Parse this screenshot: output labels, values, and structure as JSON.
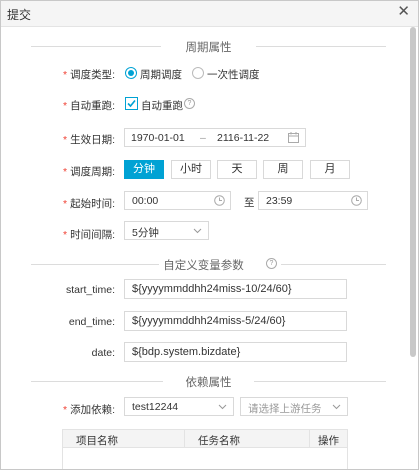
{
  "dialog": {
    "title": "提交"
  },
  "section_period": {
    "label": "周期属性"
  },
  "schedule_type": {
    "label": "调度类型:",
    "options": [
      "周期调度",
      "一次性调度"
    ],
    "selected": "周期调度"
  },
  "auto_rerun": {
    "label": "自动重跑:",
    "checkbox_label": "自动重跑",
    "checked": true
  },
  "effective_date": {
    "label": "生效日期:",
    "start": "1970-01-01",
    "separator": "–",
    "end": "2116-11-22"
  },
  "schedule_period": {
    "label": "调度周期:",
    "options": [
      "分钟",
      "小时",
      "天",
      "周",
      "月"
    ],
    "selected": "分钟"
  },
  "start_time": {
    "label": "起始时间:",
    "from": "00:00",
    "to_label": "至",
    "to": "23:59"
  },
  "interval": {
    "label": "时间间隔:",
    "value": "5分钟"
  },
  "section_params": {
    "label": "自定义变量参数"
  },
  "params": [
    {
      "label": "start_time:",
      "value": "${yyyymmddhh24miss-10/24/60}"
    },
    {
      "label": "end_time:",
      "value": "${yyyymmddhh24miss-5/24/60}"
    },
    {
      "label": "date:",
      "value": "${bdp.system.bizdate}"
    }
  ],
  "section_dep": {
    "label": "依赖属性"
  },
  "dependency": {
    "label": "添加依赖:",
    "project": "test12244",
    "task_placeholder": "请选择上游任务"
  },
  "dep_table": {
    "columns": [
      "项目名称",
      "任务名称",
      "操作"
    ]
  },
  "colors": {
    "accent": "#00a2d4",
    "required": "#f04134"
  }
}
